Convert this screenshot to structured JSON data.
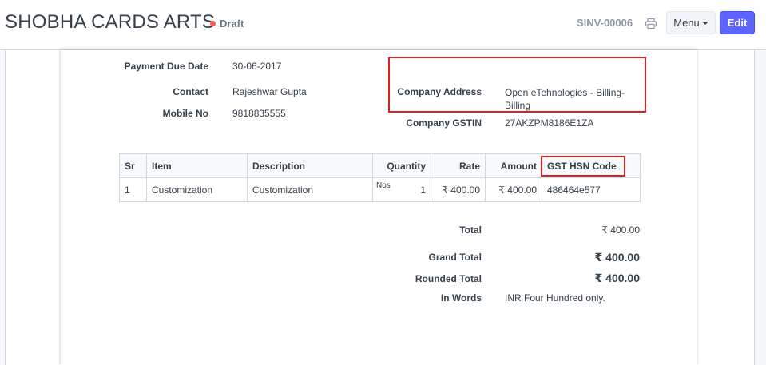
{
  "header": {
    "title": "SHOBHA CARDS ARTS",
    "status": "Draft",
    "doc_number": "SINV-00006",
    "menu_label": "Menu",
    "edit_label": "Edit"
  },
  "colors": {
    "primary": "#5e64ff",
    "draft_dot": "#ff5858",
    "highlight_box": "#e02020"
  },
  "details": {
    "payment_due_date": {
      "label": "Payment Due Date",
      "value": "30-06-2017"
    },
    "contact": {
      "label": "Contact",
      "value": "Rajeshwar Gupta"
    },
    "mobile_no": {
      "label": "Mobile No",
      "value": "9818835555"
    },
    "company_address": {
      "label": "Company Address",
      "value": "Open eTehnologies - Billing-Billing"
    },
    "company_gstin": {
      "label": "Company GSTIN",
      "value": "27AKZPM8186E1ZA"
    }
  },
  "items_table": {
    "headers": [
      "Sr",
      "Item",
      "Description",
      "Quantity",
      "Rate",
      "Amount",
      "GST HSN Code"
    ],
    "rows": [
      {
        "sr": "1",
        "item": "Customization",
        "description": "Customization",
        "uom": "Nos",
        "qty": "1",
        "rate": "₹ 400.00",
        "amount": "₹ 400.00",
        "hsn": "486464e577"
      }
    ]
  },
  "totals": {
    "total": {
      "label": "Total",
      "value": "₹ 400.00"
    },
    "grand_total": {
      "label": "Grand Total",
      "value": "₹ 400.00"
    },
    "rounded_total": {
      "label": "Rounded Total",
      "value": "₹ 400.00"
    },
    "in_words": {
      "label": "In Words",
      "value": "INR Four Hundred only."
    }
  }
}
